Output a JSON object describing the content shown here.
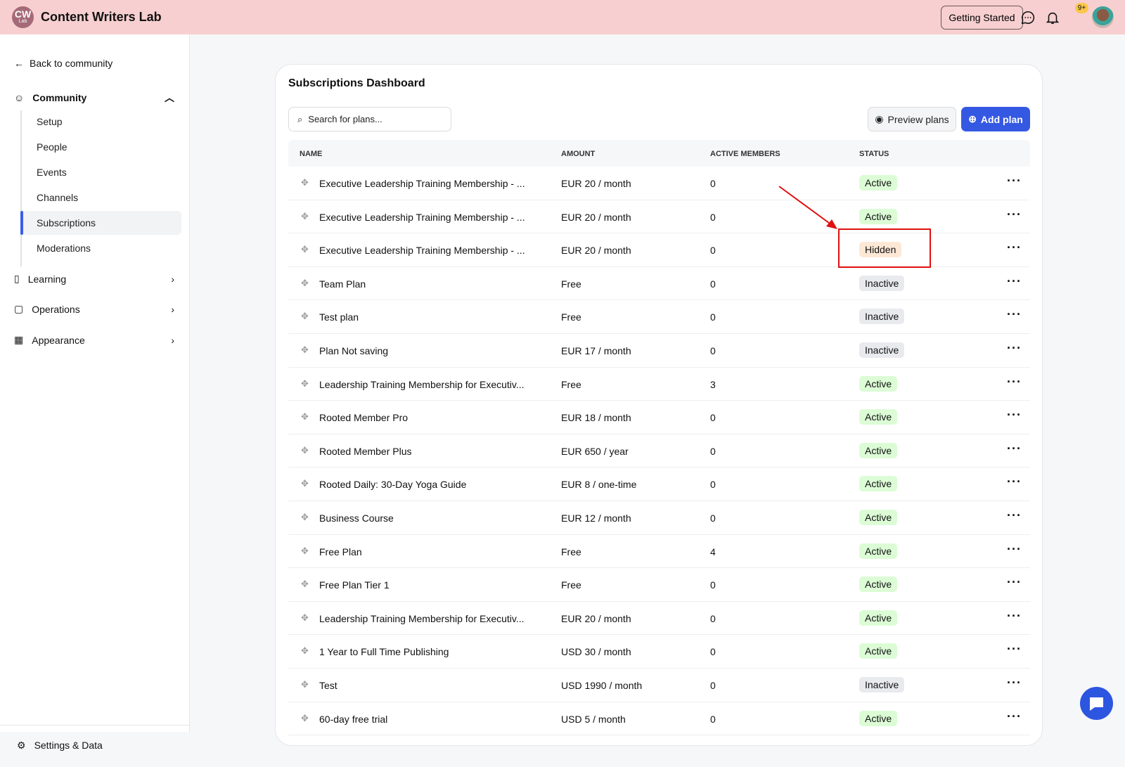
{
  "header": {
    "logo_text": "CW",
    "logo_sub": "Lab",
    "brand": "Content Writers Lab",
    "getting_started": "Getting Started",
    "notif_badge": "9+"
  },
  "sidebar": {
    "back": "Back to community",
    "community": "Community",
    "sub_items": [
      "Setup",
      "People",
      "Events",
      "Channels",
      "Subscriptions",
      "Moderations"
    ],
    "sections": [
      "Learning",
      "Operations",
      "Appearance"
    ],
    "settings": "Settings & Data"
  },
  "main": {
    "title": "Subscriptions Dashboard",
    "search_placeholder": "Search for plans...",
    "preview": "Preview plans",
    "add": "Add plan",
    "columns": [
      "NAME",
      "AMOUNT",
      "ACTIVE MEMBERS",
      "STATUS"
    ],
    "rows": [
      [
        "Executive Leadership Training Membership - ...",
        "EUR 20 / month",
        "0",
        "Active"
      ],
      [
        "Executive Leadership Training Membership - ...",
        "EUR 20 / month",
        "0",
        "Active"
      ],
      [
        "Executive Leadership Training Membership - ...",
        "EUR 20 / month",
        "0",
        "Hidden"
      ],
      [
        "Team Plan",
        "Free",
        "0",
        "Inactive"
      ],
      [
        "Test plan",
        "Free",
        "0",
        "Inactive"
      ],
      [
        "Plan Not saving",
        "EUR 17 / month",
        "0",
        "Inactive"
      ],
      [
        "Leadership Training Membership for Executiv...",
        "Free",
        "3",
        "Active"
      ],
      [
        "Rooted Member Pro",
        "EUR 18 / month",
        "0",
        "Active"
      ],
      [
        "Rooted Member Plus",
        "EUR 650 / year",
        "0",
        "Active"
      ],
      [
        "Rooted Daily: 30-Day Yoga Guide",
        "EUR 8 / one-time",
        "0",
        "Active"
      ],
      [
        "Business Course",
        "EUR 12 / month",
        "0",
        "Active"
      ],
      [
        "Free Plan",
        "Free",
        "4",
        "Active"
      ],
      [
        "Free Plan Tier 1",
        "Free",
        "0",
        "Active"
      ],
      [
        "Leadership Training Membership for Executiv...",
        "EUR 20 / month",
        "0",
        "Active"
      ],
      [
        "1 Year to Full Time Publishing",
        "USD 30 / month",
        "0",
        "Active"
      ],
      [
        "Test",
        "USD 1990 / month",
        "0",
        "Inactive"
      ],
      [
        "60-day free trial",
        "USD 5 / month",
        "0",
        "Active"
      ]
    ]
  }
}
